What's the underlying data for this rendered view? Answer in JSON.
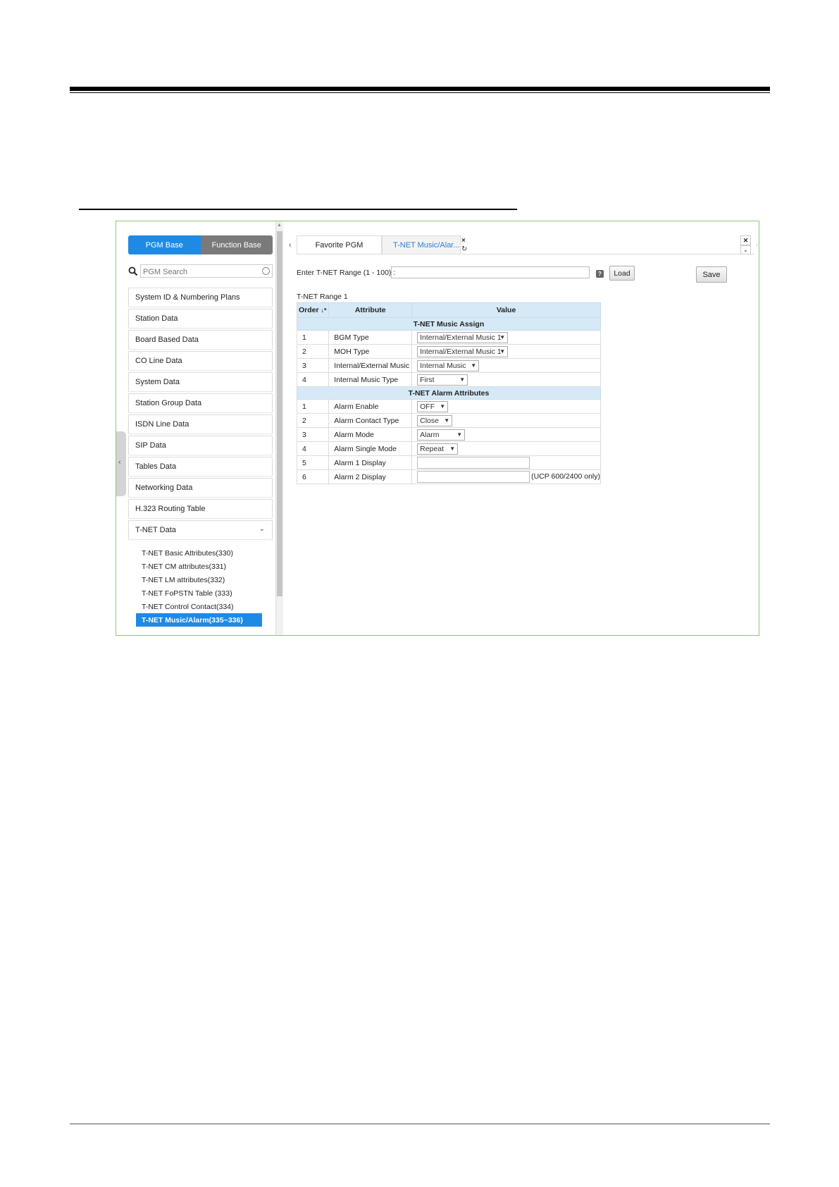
{
  "left_panel": {
    "base_tabs": [
      "PGM Base",
      "Function Base"
    ],
    "search_placeholder": "PGM Search",
    "nav_items": [
      "System ID & Numbering Plans",
      "Station Data",
      "Board Based Data",
      "CO Line Data",
      "System Data",
      "Station Group Data",
      "ISDN Line Data",
      "SIP Data",
      "Tables Data",
      "Networking Data",
      "H.323 Routing Table",
      "T-NET Data"
    ],
    "sub_items": [
      "T-NET Basic Attributes(330)",
      "T-NET CM attributes(331)",
      "T-NET LM attributes(332)",
      "T-NET FoPSTN Table (333)",
      "T-NET Control Contact(334)",
      "T-NET Music/Alarm(335~336)"
    ]
  },
  "tabs": {
    "favorite": "Favorite PGM",
    "current": "T-NET Music/Alar..."
  },
  "form": {
    "range_label": "Enter T-NET Range (1 - 100) :",
    "help": "?",
    "load": "Load",
    "save": "Save",
    "range_title": "T-NET Range 1"
  },
  "table": {
    "headers": [
      "Order",
      "Attribute",
      "Value"
    ],
    "section1": "T-NET Music Assign",
    "music_rows": [
      {
        "order": "1",
        "attribute": "BGM Type",
        "value": "Internal/External Music 1"
      },
      {
        "order": "2",
        "attribute": "MOH Type",
        "value": "Internal/External Music 1"
      },
      {
        "order": "3",
        "attribute": "Internal/External Music",
        "value": "Internal Music"
      },
      {
        "order": "4",
        "attribute": "Internal Music Type",
        "value": "First"
      }
    ],
    "section2": "T-NET Alarm Attributes",
    "alarm_rows": [
      {
        "order": "1",
        "attribute": "Alarm Enable",
        "value": "OFF"
      },
      {
        "order": "2",
        "attribute": "Alarm Contact Type",
        "value": "Close"
      },
      {
        "order": "3",
        "attribute": "Alarm Mode",
        "value": "Alarm"
      },
      {
        "order": "4",
        "attribute": "Alarm Single Mode",
        "value": "Repeat"
      },
      {
        "order": "5",
        "attribute": "Alarm 1 Display",
        "value": ""
      },
      {
        "order": "6",
        "attribute": "Alarm 2 Display",
        "value": ""
      }
    ],
    "alarm2_note": "(UCP 600/2400 only)"
  }
}
